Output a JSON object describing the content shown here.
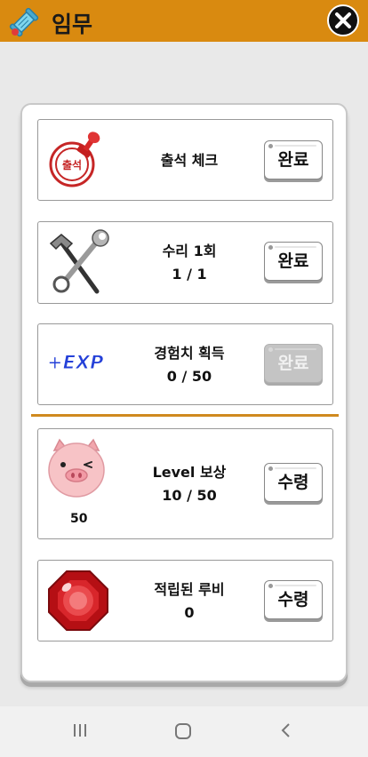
{
  "header": {
    "title": "임무",
    "scroll_icon": "scroll-icon",
    "close_icon": "close-icon"
  },
  "missions": [
    {
      "icon": "stamp-icon",
      "line1": "출석 체크",
      "line2": "",
      "button": "완료",
      "button_enabled": true
    },
    {
      "icon": "hammer-wrench-icon",
      "line1": "수리 1회",
      "line2": "1 / 1",
      "button": "완료",
      "button_enabled": true
    },
    {
      "icon": "exp-icon",
      "line1": "경험치 획득",
      "line2": "0 / 50",
      "button": "완료",
      "button_enabled": false
    }
  ],
  "rewards": [
    {
      "icon": "pig-icon",
      "icon_value": "50",
      "line1": "Level 보상",
      "line2": "10 / 50",
      "button": "수령",
      "button_enabled": true
    },
    {
      "icon": "ruby-icon",
      "line1": "적립된 루비",
      "line2": "0",
      "button": "수령",
      "button_enabled": true
    }
  ],
  "exp_icon_text": "+EXP",
  "stamp_icon_text": "출석",
  "navbar": {
    "icons": [
      "recent-apps-icon",
      "home-icon",
      "back-icon"
    ]
  },
  "colors": {
    "header": "#d98a10",
    "divider": "#d08a1f",
    "disabled_button": "#c4c4c4"
  }
}
